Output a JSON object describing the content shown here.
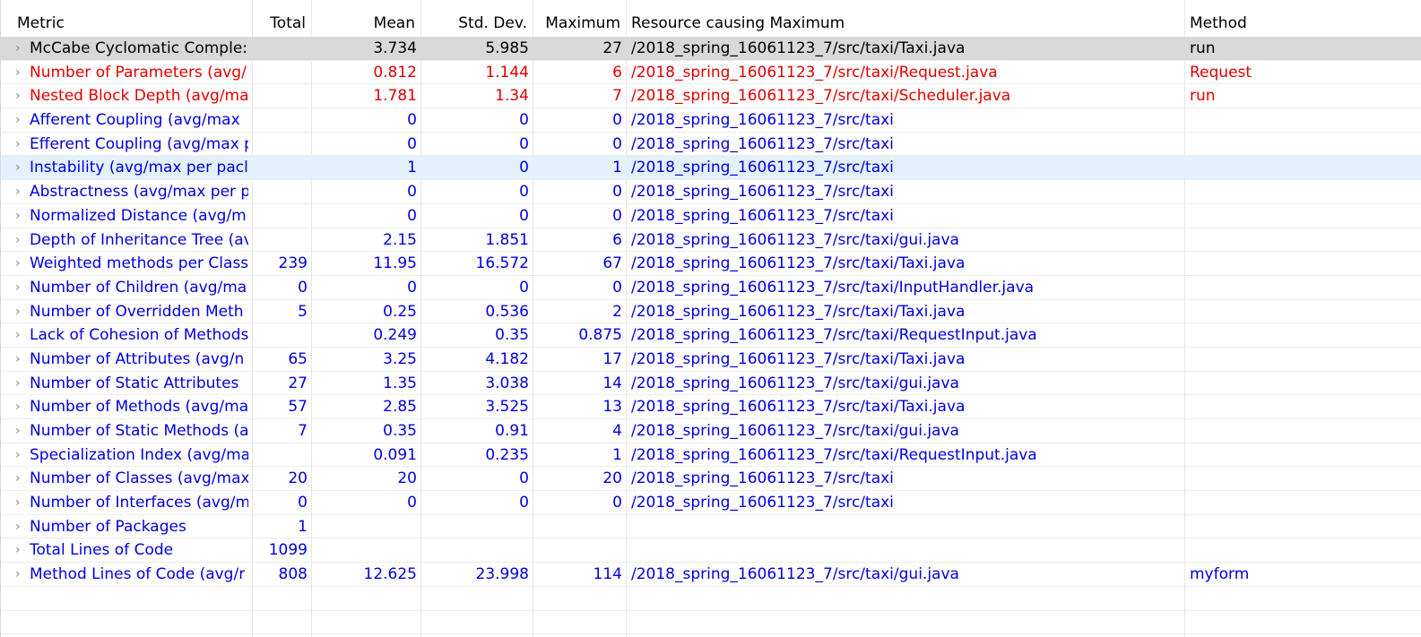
{
  "header": {
    "metric": "Metric",
    "total": "Total",
    "mean": "Mean",
    "std": "Std. Dev.",
    "maximum": "Maximum",
    "resource": "Resource causing Maximum",
    "method": "Method"
  },
  "colors": {
    "normal": "#000000",
    "warning": "#e00000",
    "ok": "#0000e0",
    "selected_row": "#d9d9d9",
    "hover_row": "#e3f1fc"
  },
  "rows": [
    {
      "metric": "McCabe Cyclomatic Comple:",
      "total": "",
      "mean": "3.734",
      "std": "5.985",
      "max": "27",
      "resource": "/2018_spring_16061123_7/src/taxi/Taxi.java",
      "method": "run",
      "color": "black",
      "state": "selected"
    },
    {
      "metric": "Number of Parameters (avg/",
      "total": "",
      "mean": "0.812",
      "std": "1.144",
      "max": "6",
      "resource": "/2018_spring_16061123_7/src/taxi/Request.java",
      "method": "Request",
      "color": "red",
      "state": ""
    },
    {
      "metric": "Nested Block Depth (avg/ma",
      "total": "",
      "mean": "1.781",
      "std": "1.34",
      "max": "7",
      "resource": "/2018_spring_16061123_7/src/taxi/Scheduler.java",
      "method": "run",
      "color": "red",
      "state": ""
    },
    {
      "metric": "Afferent Coupling (avg/max",
      "total": "",
      "mean": "0",
      "std": "0",
      "max": "0",
      "resource": "/2018_spring_16061123_7/src/taxi",
      "method": "",
      "color": "blue",
      "state": ""
    },
    {
      "metric": "Efferent Coupling (avg/max p",
      "total": "",
      "mean": "0",
      "std": "0",
      "max": "0",
      "resource": "/2018_spring_16061123_7/src/taxi",
      "method": "",
      "color": "blue",
      "state": ""
    },
    {
      "metric": "Instability (avg/max per pacl",
      "total": "",
      "mean": "1",
      "std": "0",
      "max": "1",
      "resource": "/2018_spring_16061123_7/src/taxi",
      "method": "",
      "color": "blue",
      "state": "hover"
    },
    {
      "metric": "Abstractness (avg/max per p",
      "total": "",
      "mean": "0",
      "std": "0",
      "max": "0",
      "resource": "/2018_spring_16061123_7/src/taxi",
      "method": "",
      "color": "blue",
      "state": ""
    },
    {
      "metric": "Normalized Distance (avg/m",
      "total": "",
      "mean": "0",
      "std": "0",
      "max": "0",
      "resource": "/2018_spring_16061123_7/src/taxi",
      "method": "",
      "color": "blue",
      "state": ""
    },
    {
      "metric": "Depth of Inheritance Tree (av",
      "total": "",
      "mean": "2.15",
      "std": "1.851",
      "max": "6",
      "resource": "/2018_spring_16061123_7/src/taxi/gui.java",
      "method": "",
      "color": "blue",
      "state": ""
    },
    {
      "metric": "Weighted methods per Class",
      "total": "239",
      "mean": "11.95",
      "std": "16.572",
      "max": "67",
      "resource": "/2018_spring_16061123_7/src/taxi/Taxi.java",
      "method": "",
      "color": "blue",
      "state": ""
    },
    {
      "metric": "Number of Children (avg/ma",
      "total": "0",
      "mean": "0",
      "std": "0",
      "max": "0",
      "resource": "/2018_spring_16061123_7/src/taxi/InputHandler.java",
      "method": "",
      "color": "blue",
      "state": ""
    },
    {
      "metric": "Number of Overridden Meth",
      "total": "5",
      "mean": "0.25",
      "std": "0.536",
      "max": "2",
      "resource": "/2018_spring_16061123_7/src/taxi/Taxi.java",
      "method": "",
      "color": "blue",
      "state": ""
    },
    {
      "metric": "Lack of Cohesion of Methods",
      "total": "",
      "mean": "0.249",
      "std": "0.35",
      "max": "0.875",
      "resource": "/2018_spring_16061123_7/src/taxi/RequestInput.java",
      "method": "",
      "color": "blue",
      "state": ""
    },
    {
      "metric": "Number of Attributes (avg/n",
      "total": "65",
      "mean": "3.25",
      "std": "4.182",
      "max": "17",
      "resource": "/2018_spring_16061123_7/src/taxi/Taxi.java",
      "method": "",
      "color": "blue",
      "state": ""
    },
    {
      "metric": "Number of Static Attributes",
      "total": "27",
      "mean": "1.35",
      "std": "3.038",
      "max": "14",
      "resource": "/2018_spring_16061123_7/src/taxi/gui.java",
      "method": "",
      "color": "blue",
      "state": ""
    },
    {
      "metric": "Number of Methods (avg/ma",
      "total": "57",
      "mean": "2.85",
      "std": "3.525",
      "max": "13",
      "resource": "/2018_spring_16061123_7/src/taxi/Taxi.java",
      "method": "",
      "color": "blue",
      "state": ""
    },
    {
      "metric": "Number of Static Methods (a",
      "total": "7",
      "mean": "0.35",
      "std": "0.91",
      "max": "4",
      "resource": "/2018_spring_16061123_7/src/taxi/gui.java",
      "method": "",
      "color": "blue",
      "state": ""
    },
    {
      "metric": "Specialization Index (avg/ma",
      "total": "",
      "mean": "0.091",
      "std": "0.235",
      "max": "1",
      "resource": "/2018_spring_16061123_7/src/taxi/RequestInput.java",
      "method": "",
      "color": "blue",
      "state": ""
    },
    {
      "metric": "Number of Classes (avg/max",
      "total": "20",
      "mean": "20",
      "std": "0",
      "max": "20",
      "resource": "/2018_spring_16061123_7/src/taxi",
      "method": "",
      "color": "blue",
      "state": ""
    },
    {
      "metric": "Number of Interfaces (avg/m",
      "total": "0",
      "mean": "0",
      "std": "0",
      "max": "0",
      "resource": "/2018_spring_16061123_7/src/taxi",
      "method": "",
      "color": "blue",
      "state": ""
    },
    {
      "metric": "Number of Packages",
      "total": "1",
      "mean": "",
      "std": "",
      "max": "",
      "resource": "",
      "method": "",
      "color": "blue",
      "state": ""
    },
    {
      "metric": "Total Lines of Code",
      "total": "1099",
      "mean": "",
      "std": "",
      "max": "",
      "resource": "",
      "method": "",
      "color": "blue",
      "state": ""
    },
    {
      "metric": "Method Lines of Code (avg/r",
      "total": "808",
      "mean": "12.625",
      "std": "23.998",
      "max": "114",
      "resource": "/2018_spring_16061123_7/src/taxi/gui.java",
      "method": "myform",
      "color": "blue",
      "state": ""
    }
  ]
}
